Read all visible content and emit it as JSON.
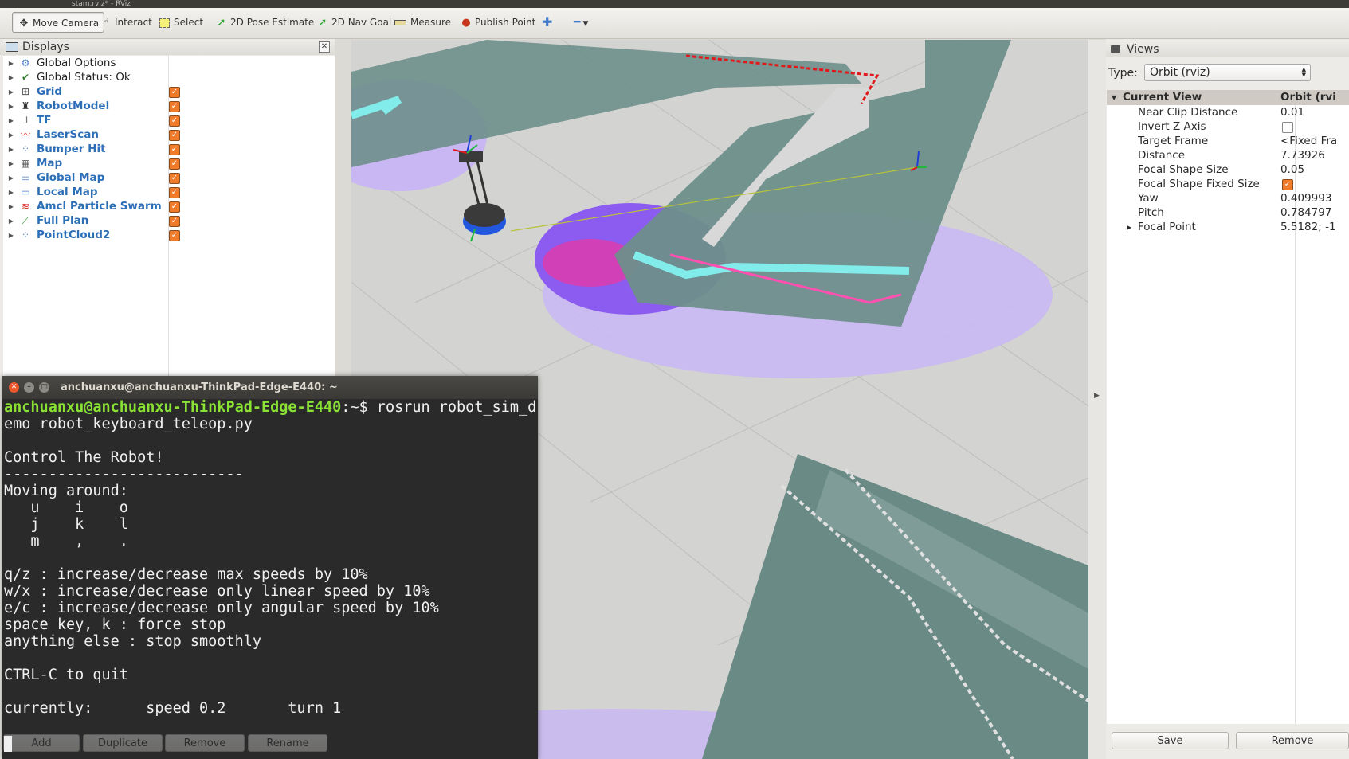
{
  "window": {
    "title": "stam.rviz* - RViz"
  },
  "toolbar": {
    "tools": [
      {
        "label": "Move Camera",
        "icon": "move-camera-icon",
        "active": true
      },
      {
        "label": "Interact",
        "icon": "hand-icon"
      },
      {
        "label": "Select",
        "icon": "select-box-icon"
      },
      {
        "label": "2D Pose Estimate",
        "icon": "green-arrow-icon"
      },
      {
        "label": "2D Nav Goal",
        "icon": "green-arrow-icon"
      },
      {
        "label": "Measure",
        "icon": "ruler-icon"
      },
      {
        "label": "Publish Point",
        "icon": "map-pin-icon"
      }
    ]
  },
  "displays": {
    "title": "Displays",
    "items": [
      {
        "label": "Global Options",
        "icon": "gear-icon",
        "checkbox": false
      },
      {
        "label": "Global Status: Ok",
        "icon": "checkmark-icon",
        "checkbox": false
      },
      {
        "label": "Grid",
        "icon": "grid-icon",
        "checked": true
      },
      {
        "label": "RobotModel",
        "icon": "robot-icon",
        "checked": true
      },
      {
        "label": "TF",
        "icon": "tf-axes-icon",
        "checked": true
      },
      {
        "label": "LaserScan",
        "icon": "laser-scan-icon",
        "checked": true
      },
      {
        "label": "Bumper Hit",
        "icon": "pointcloud-icon",
        "checked": true
      },
      {
        "label": "Map",
        "icon": "map-icon",
        "checked": true
      },
      {
        "label": "Global Map",
        "icon": "folder-icon",
        "checked": true
      },
      {
        "label": "Local Map",
        "icon": "folder-icon",
        "checked": true
      },
      {
        "label": "Amcl Particle Swarm",
        "icon": "particle-swarm-icon",
        "checked": true
      },
      {
        "label": "Full Plan",
        "icon": "path-icon",
        "checked": true
      },
      {
        "label": "PointCloud2",
        "icon": "pointcloud-icon",
        "checked": true
      }
    ],
    "buttons": [
      "Add",
      "Duplicate",
      "Remove",
      "Rename"
    ]
  },
  "terminal": {
    "title": "anchuanxu@anchuanxu-ThinkPad-Edge-E440: ~",
    "prompt_user": "anchuanxu@anchuanxu-ThinkPad-Edge-E440",
    "prompt_rest": ":~$ rosrun robot_sim_d",
    "lines": [
      "emo robot_keyboard_teleop.py",
      "",
      "Control The Robot!",
      "---------------------------",
      "Moving around:",
      "   u    i    o",
      "   j    k    l",
      "   m    ,    .",
      "",
      "q/z : increase/decrease max speeds by 10%",
      "w/x : increase/decrease only linear speed by 10%",
      "e/c : increase/decrease only angular speed by 10%",
      "space key, k : force stop",
      "anything else : stop smoothly",
      "",
      "CTRL-C to quit",
      "",
      "currently:      speed 0.2       turn 1"
    ]
  },
  "views": {
    "title": "Views",
    "type_label": "Type:",
    "type_value": "Orbit (rviz)",
    "header_name": "Current View",
    "header_value": "Orbit (rvi",
    "props": [
      {
        "name": "Near Clip Distance",
        "value": "0.01"
      },
      {
        "name": "Invert Z Axis",
        "value": "",
        "checkbox": "unchecked"
      },
      {
        "name": "Target Frame",
        "value": "<Fixed Fra"
      },
      {
        "name": "Distance",
        "value": "7.73926"
      },
      {
        "name": "Focal Shape Size",
        "value": "0.05"
      },
      {
        "name": "Focal Shape Fixed Size",
        "value": "",
        "checkbox": "checked"
      },
      {
        "name": "Yaw",
        "value": "0.409993"
      },
      {
        "name": "Pitch",
        "value": "0.784797"
      },
      {
        "name": "Focal Point",
        "value": "5.5182; -1",
        "expandable": true
      }
    ],
    "buttons": {
      "save": "Save",
      "remove": "Remove"
    }
  },
  "colors": {
    "costmap_inflation": "#7b5cf0",
    "costmap_lethal": "#ff2a9d",
    "costmap_cyan": "#7de9e6",
    "map_occupied": "#6c8e89",
    "terminal_prompt": "#8ae234",
    "checkbox": "#f07b2a",
    "display_name": "#2d6fb7"
  }
}
